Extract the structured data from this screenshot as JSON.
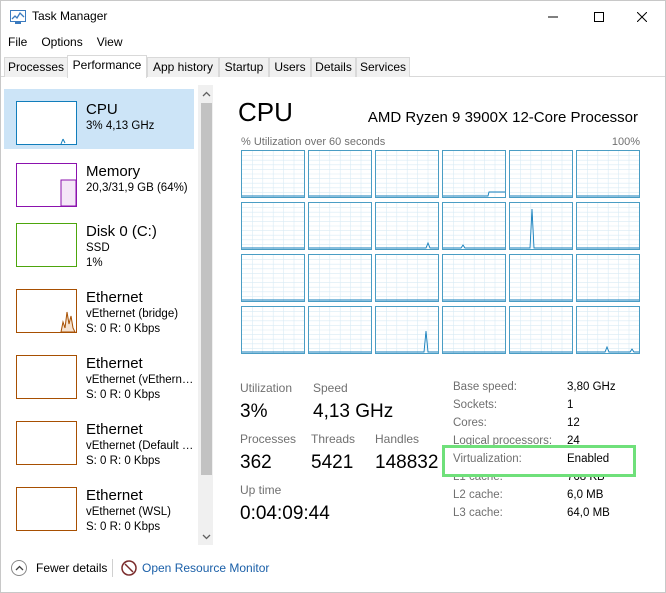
{
  "window": {
    "title": "Task Manager"
  },
  "menu": [
    "File",
    "Options",
    "View"
  ],
  "tabs": [
    "Processes",
    "Performance",
    "App history",
    "Startup",
    "Users",
    "Details",
    "Services"
  ],
  "active_tab": "Performance",
  "sidebar": [
    {
      "title": "CPU",
      "sub1": "3% 4,13 GHz",
      "sub2": "",
      "color": "#117dbb"
    },
    {
      "title": "Memory",
      "sub1": "20,3/31,9 GB (64%)",
      "sub2": "",
      "color": "#8b12ae"
    },
    {
      "title": "Disk 0 (C:)",
      "sub1": "SSD",
      "sub2": "1%",
      "color": "#4da60c"
    },
    {
      "title": "Ethernet",
      "sub1": "vEthernet (bridge)",
      "sub2": "S: 0 R: 0 Kbps",
      "color": "#a74f01"
    },
    {
      "title": "Ethernet",
      "sub1": "vEthernet (vEthern…",
      "sub2": "S: 0 R: 0 Kbps",
      "color": "#a74f01"
    },
    {
      "title": "Ethernet",
      "sub1": "vEthernet (Default …",
      "sub2": "S: 0 R: 0 Kbps",
      "color": "#a74f01"
    },
    {
      "title": "Ethernet",
      "sub1": "vEthernet (WSL)",
      "sub2": "S: 0 R: 0 Kbps",
      "color": "#a74f01"
    }
  ],
  "main": {
    "title": "CPU",
    "model": "AMD Ryzen 9 3900X 12-Core Processor",
    "graph_label": "% Utilization over 60 seconds",
    "graph_max": "100%",
    "stats": {
      "utilization_label": "Utilization",
      "utilization": "3%",
      "speed_label": "Speed",
      "speed": "4,13 GHz",
      "processes_label": "Processes",
      "processes": "362",
      "threads_label": "Threads",
      "threads": "5421",
      "handles_label": "Handles",
      "handles": "148832",
      "uptime_label": "Up time",
      "uptime": "0:04:09:44"
    },
    "details": [
      {
        "label": "Base speed:",
        "value": "3,80 GHz"
      },
      {
        "label": "Sockets:",
        "value": "1"
      },
      {
        "label": "Cores:",
        "value": "12"
      },
      {
        "label": "Logical processors:",
        "value": "24"
      },
      {
        "label": "Virtualization:",
        "value": "Enabled"
      },
      {
        "label": "L1 cache:",
        "value": "768 KB"
      },
      {
        "label": "L2 cache:",
        "value": "6,0 MB"
      },
      {
        "label": "L3 cache:",
        "value": "64,0 MB"
      }
    ]
  },
  "footer": {
    "fewer_details": "Fewer details",
    "resource_monitor": "Open Resource Monitor"
  },
  "colors": {
    "accent": "#117dbb",
    "highlight": "#6fe07a",
    "selection": "#cce4f7"
  }
}
